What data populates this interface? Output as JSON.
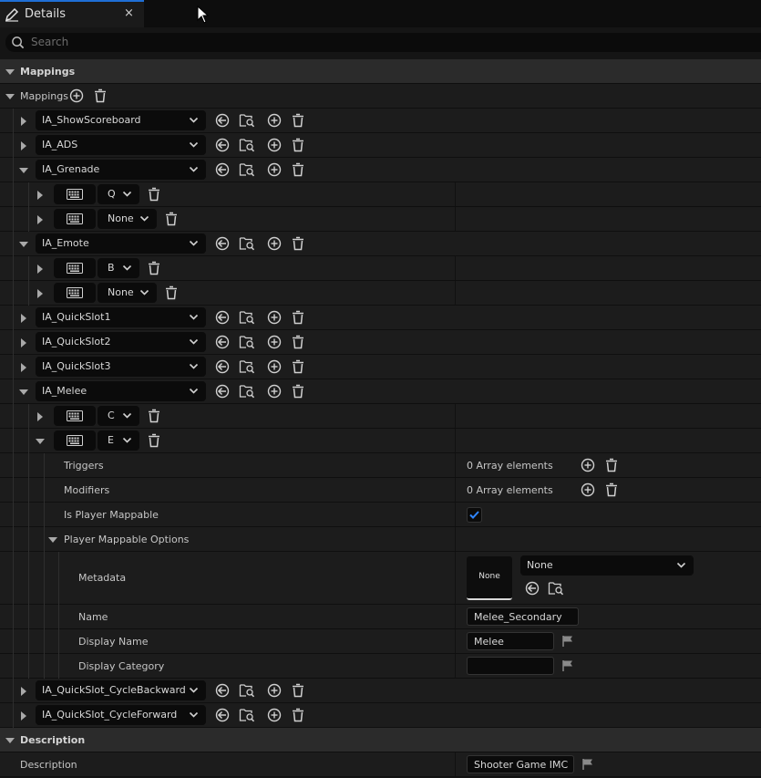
{
  "tab": {
    "title": "Details",
    "close_glyph": "×"
  },
  "search": {
    "placeholder": "Search",
    "value": ""
  },
  "sections": {
    "mappings": "Mappings",
    "description": "Description"
  },
  "mappings_array_label": "Mappings",
  "mappings": [
    {
      "action": "IA_ShowScoreboard",
      "expanded": false
    },
    {
      "action": "IA_ADS",
      "expanded": false
    },
    {
      "action": "IA_Grenade",
      "expanded": true,
      "keys": [
        {
          "key": "Q"
        },
        {
          "key": "None"
        }
      ]
    },
    {
      "action": "IA_Emote",
      "expanded": true,
      "keys": [
        {
          "key": "B"
        },
        {
          "key": "None"
        }
      ]
    },
    {
      "action": "IA_QuickSlot1",
      "expanded": false
    },
    {
      "action": "IA_QuickSlot2",
      "expanded": false
    },
    {
      "action": "IA_QuickSlot3",
      "expanded": false
    },
    {
      "action": "IA_Melee",
      "expanded": true,
      "keys": [
        {
          "key": "C"
        },
        {
          "key": "E",
          "expanded": true
        }
      ]
    },
    {
      "action": "IA_QuickSlot_CycleBackward",
      "expanded": false
    },
    {
      "action": "IA_QuickSlot_CycleForward",
      "expanded": false
    }
  ],
  "melee_e": {
    "triggers_label": "Triggers",
    "triggers_value": "0 Array elements",
    "modifiers_label": "Modifiers",
    "modifiers_value": "0 Array elements",
    "is_player_mappable_label": "Is Player Mappable",
    "is_player_mappable": true,
    "options_label": "Player Mappable Options",
    "metadata_label": "Metadata",
    "metadata_thumb": "None",
    "metadata_value": "None",
    "name_label": "Name",
    "name_value": "Melee_Secondary",
    "display_name_label": "Display Name",
    "display_name_value": "Melee",
    "display_category_label": "Display Category",
    "display_category_value": ""
  },
  "description": {
    "label": "Description",
    "value": "Shooter Game IMC"
  },
  "icons": {
    "tab": "pencil-icon",
    "search": "search-icon",
    "close": "close-icon",
    "add": "add-circle-icon",
    "delete": "trash-icon",
    "use": "use-selected-arrow-icon",
    "browse": "browse-folder-icon",
    "keyboard": "keyboard-icon",
    "flag": "localization-flag-icon",
    "chevron": "chevron-down-icon",
    "check": "checkmark-icon"
  },
  "colors": {
    "accent": "#1f6fd6",
    "panel": "#1c1c1c",
    "section": "#2b2b2b",
    "input": "#0b0b0b"
  }
}
